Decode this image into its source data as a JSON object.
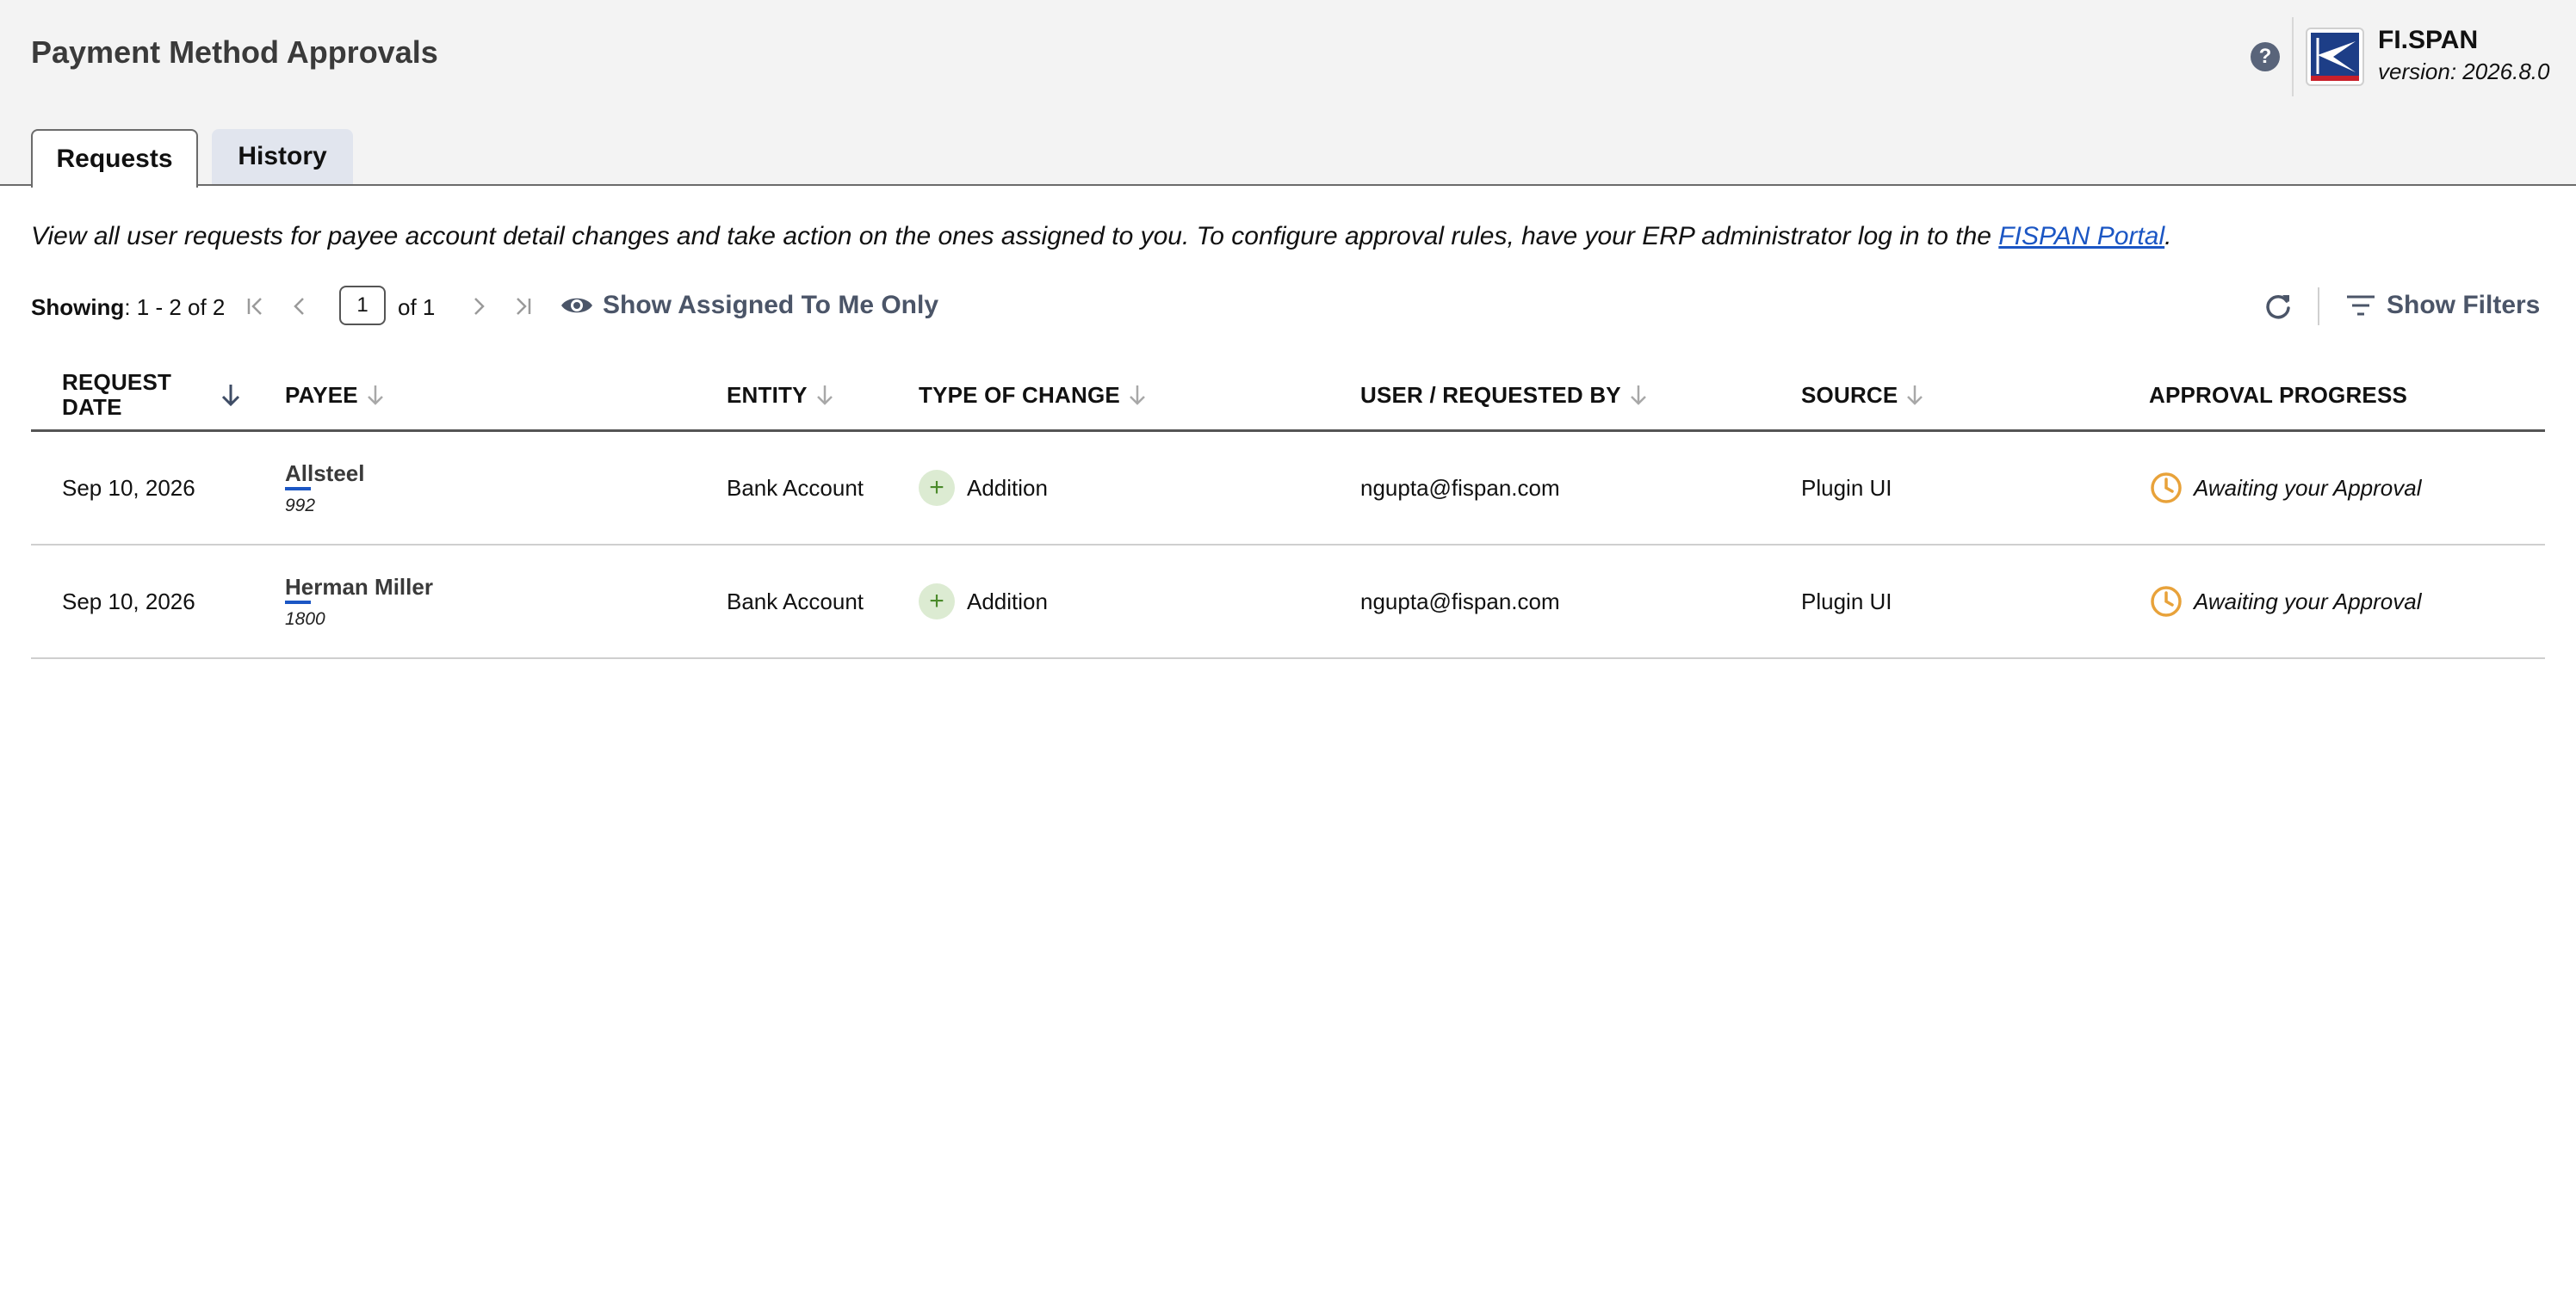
{
  "header": {
    "title": "Payment Method Approvals",
    "help_icon": "question-circle-icon",
    "brand_name": "FI.SPAN",
    "version": "version: 2026.8.0"
  },
  "tabs": [
    {
      "label": "Requests",
      "active": true
    },
    {
      "label": "History",
      "active": false
    }
  ],
  "intro": {
    "text": "View all user requests for payee account detail changes and take action on the ones assigned to you. To configure approval rules, have your ERP administrator log in to the ",
    "link_text": "FISPAN Portal",
    "suffix": "."
  },
  "toolbar": {
    "showing_label": "Showing",
    "showing_range": ": 1 - 2 of 2",
    "page_value": "1",
    "of_pages": "of 1",
    "assigned_label": "Show Assigned To Me Only",
    "filters_label": "Show Filters"
  },
  "columns": [
    {
      "label_line1": "REQUEST",
      "label_line2": "DATE"
    },
    {
      "label": "PAYEE"
    },
    {
      "label": "ENTITY"
    },
    {
      "label": "TYPE OF CHANGE"
    },
    {
      "label": "USER / REQUESTED BY"
    },
    {
      "label": "SOURCE"
    },
    {
      "label": "APPROVAL PROGRESS"
    }
  ],
  "rows": [
    {
      "date": "Sep 10, 2026",
      "payee": "Allsteel",
      "payee_id": "992",
      "entity": "Bank Account",
      "change": "Addition",
      "user": "ngupta@fispan.com",
      "source": "Plugin UI",
      "approval": "Awaiting your Approval"
    },
    {
      "date": "Sep 10, 2026",
      "payee": "Herman Miller",
      "payee_id": "1800",
      "entity": "Bank Account",
      "change": "Addition",
      "user": "ngupta@fispan.com",
      "source": "Plugin UI",
      "approval": "Awaiting your Approval"
    }
  ],
  "colors": {
    "accent": "#1b56c4",
    "muted_action": "#4b5568",
    "clock": "#e8a23a",
    "addition_bg": "#dcebd2",
    "addition_fg": "#4a8a2a"
  }
}
